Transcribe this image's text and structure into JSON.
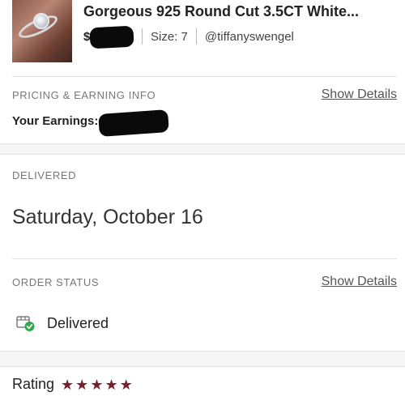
{
  "item": {
    "title": "Gorgeous 925 Round Cut 3.5CT White...",
    "price_symbol": "$",
    "size": "Size: 7",
    "seller": "@tiffanyswengel"
  },
  "pricing": {
    "section_label": "PRICING & EARNING INFO",
    "show_details_label": "Show Details",
    "earnings_label": "Your Earnings:"
  },
  "delivered": {
    "section_label": "DELIVERED",
    "date": "Saturday, October 16"
  },
  "order_status": {
    "section_label": "ORDER STATUS",
    "show_details_label": "Show Details",
    "status": "Delivered",
    "icon": "package-check-icon"
  },
  "rating": {
    "label": "Rating",
    "stars": 5,
    "max_stars": 5,
    "star_color": "#7a1f2b"
  },
  "colors": {
    "accent_check": "#2eaa4a",
    "redaction": "#0a0a0a"
  }
}
